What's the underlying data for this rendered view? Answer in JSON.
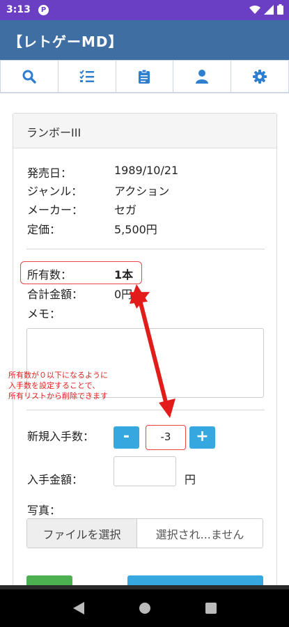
{
  "status_bar": {
    "time": "3:13",
    "app_icon_letter": "P"
  },
  "app": {
    "title": "【レトゲーMD】"
  },
  "toolbar": {
    "items": [
      {
        "icon": "search-icon"
      },
      {
        "icon": "checklist-icon"
      },
      {
        "icon": "clipboard-icon"
      },
      {
        "icon": "user-icon"
      },
      {
        "icon": "gear-icon"
      }
    ]
  },
  "game": {
    "title": "ランボーIII",
    "details": [
      {
        "label": "発売日：",
        "value": "1989/10/21"
      },
      {
        "label": "ジャンル：",
        "value": "アクション"
      },
      {
        "label": "メーカー：",
        "value": "セガ"
      },
      {
        "label": "定価：",
        "value": "5,500円"
      }
    ],
    "owned": {
      "label": "所有数：",
      "value": "1本"
    },
    "total": {
      "label": "合計金額：",
      "value": "0円"
    },
    "memo": {
      "label": "メモ：",
      "value": ""
    }
  },
  "annotation": {
    "lines": [
      "所有数が０以下になるように",
      "入手数を設定することで、",
      "所有リストから削除できます"
    ]
  },
  "form": {
    "new_qty": {
      "label": "新規入手数：",
      "value": "-3",
      "minus": "-",
      "plus": "+"
    },
    "price": {
      "label": "入手金額：",
      "unit": "円",
      "value": ""
    },
    "photo": {
      "label": "写真：",
      "button": "ファイルを選択",
      "status": "選択され...ません"
    }
  },
  "colors": {
    "status_bar": "#6a3fc4",
    "header": "#3f6ea3",
    "accent": "#37a7e0",
    "annotation": "#e02020",
    "green_button": "#4caf50"
  }
}
